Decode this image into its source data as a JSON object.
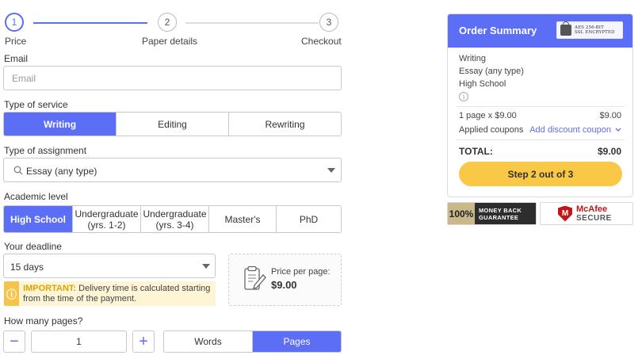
{
  "stepper": {
    "steps": [
      {
        "number": "1",
        "label": "Price"
      },
      {
        "number": "2",
        "label": "Paper details"
      },
      {
        "number": "3",
        "label": "Checkout"
      }
    ]
  },
  "email": {
    "label": "Email",
    "placeholder": "Email",
    "value": ""
  },
  "service": {
    "label": "Type of service",
    "options": [
      "Writing",
      "Editing",
      "Rewriting"
    ],
    "selected": "Writing"
  },
  "assignment": {
    "label": "Type of assignment",
    "value": "Essay (any type)"
  },
  "academic": {
    "label": "Academic level",
    "options": [
      "High School",
      "Undergraduate (yrs. 1-2)",
      "Undergraduate (yrs. 3-4)",
      "Master's",
      "PhD"
    ],
    "selected": "High School"
  },
  "deadline": {
    "label": "Your deadline",
    "value": "15 days"
  },
  "notice": {
    "strong": "IMPORTANT:",
    "text": " Delivery time is calculated starting from the time of the payment."
  },
  "price": {
    "label": "Price per page:",
    "value": "$9.00"
  },
  "pages": {
    "label": "How many pages?",
    "value": "1",
    "minus": "−",
    "plus": "+",
    "units": [
      "Words",
      "Pages"
    ],
    "selected_unit": "Pages"
  },
  "summary": {
    "title": "Order Summary",
    "ssl_line1": "AES 256-BIT",
    "ssl_line2": "SSL ENCRYPTED",
    "lines": [
      "Writing",
      "Essay (any type)",
      "High School"
    ],
    "info": "i",
    "pages_line": "1 page x $9.00",
    "pages_amount": "$9.00",
    "coupons_label": "Applied coupons",
    "coupon_link": "Add discount coupon",
    "total_label": "TOTAL:",
    "total_value": "$9.00",
    "step_button": "Step 2 out of 3"
  },
  "badges": {
    "money_back": {
      "percent": "100%",
      "line1": "MONEY BACK",
      "line2": "GUARANTEE"
    },
    "mcafee": {
      "brand": "McAfee",
      "secure": "SECURE"
    }
  },
  "colors": {
    "accent": "#5b6ef5",
    "cta": "#f9c846",
    "notice": "#fdf5d6",
    "notice_icon": "#f5c54b"
  }
}
